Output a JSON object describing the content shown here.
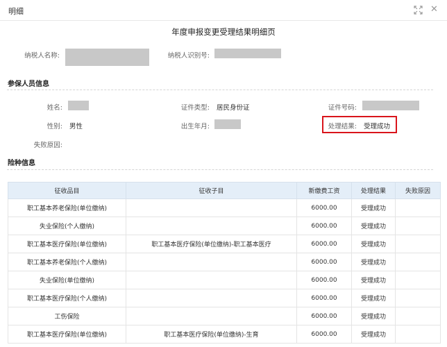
{
  "dialog": {
    "title": "明细"
  },
  "page_title": "年度申报变更受理结果明细页",
  "taxpayer": {
    "name_label": "纳税人名称:",
    "id_label": "纳税人识别号:"
  },
  "insured_section": {
    "title": "参保人员信息",
    "name_label": "姓名:",
    "id_type_label": "证件类型:",
    "id_type_value": "居民身份证",
    "id_number_label": "证件号码:",
    "gender_label": "性别:",
    "gender_value": "男性",
    "birth_label": "出生年月:",
    "result_label": "处理结果:",
    "result_value": "受理成功",
    "fail_reason_label": "失败原因:"
  },
  "insurance_section": {
    "title": "险种信息",
    "columns": [
      "征收品目",
      "征收子目",
      "新缴费工资",
      "处理结果",
      "失败原因"
    ],
    "rows": [
      [
        "职工基本养老保险(单位缴纳)",
        "",
        "6000.00",
        "受理成功",
        ""
      ],
      [
        "失业保险(个人缴纳)",
        "",
        "6000.00",
        "受理成功",
        ""
      ],
      [
        "职工基本医疗保险(单位缴纳)",
        "职工基本医疗保险(单位缴纳)-职工基本医疗",
        "6000.00",
        "受理成功",
        ""
      ],
      [
        "职工基本养老保险(个人缴纳)",
        "",
        "6000.00",
        "受理成功",
        ""
      ],
      [
        "失业保险(单位缴纳)",
        "",
        "6000.00",
        "受理成功",
        ""
      ],
      [
        "职工基本医疗保险(个人缴纳)",
        "",
        "6000.00",
        "受理成功",
        ""
      ],
      [
        "工伤保险",
        "",
        "6000.00",
        "受理成功",
        ""
      ],
      [
        "职工基本医疗保险(单位缴纳)",
        "职工基本医疗保险(单位缴纳)-生育",
        "6000.00",
        "受理成功",
        ""
      ]
    ]
  },
  "colors": {
    "header_bg": "#e4eef8",
    "highlight": "#d9141b",
    "redaction": "#c8c8c8"
  },
  "icons": {
    "expand": "expand-icon",
    "close": "close-icon"
  }
}
